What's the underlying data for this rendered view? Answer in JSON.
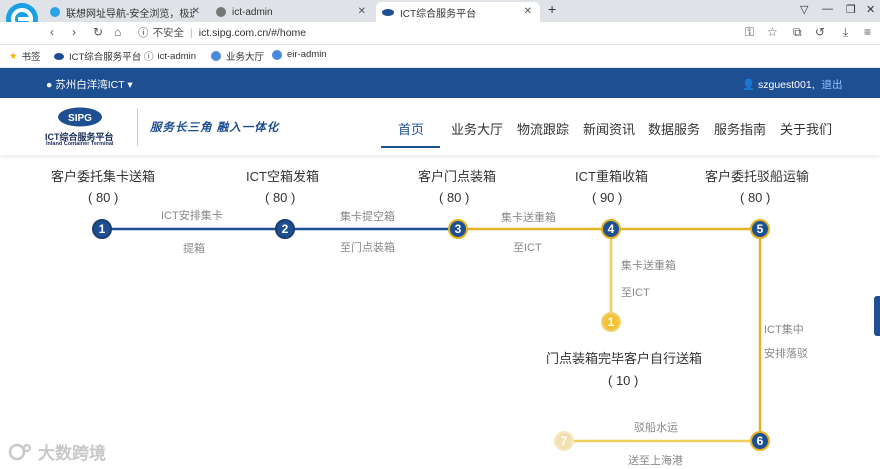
{
  "browser": {
    "tabs": [
      {
        "title": "联想网址导航-安全浏览，极速体验",
        "active": false
      },
      {
        "title": "ict-admin",
        "active": false
      },
      {
        "title": "ICT综合服务平台",
        "active": true
      }
    ],
    "new_tab": "+",
    "insecure_label": "不安全",
    "url": "ict.sipg.com.cn/#/home",
    "bookmarks": [
      "书签",
      "ICT综合服务平台",
      "ict-admin",
      "业务大厅",
      "eir-admin"
    ]
  },
  "topbar": {
    "location": "苏州白洋湾ICT",
    "user": "szguest001,",
    "logout": "退出"
  },
  "header": {
    "logo_text": "SIPG",
    "brand_title": "ICT综合服务平台",
    "brand_sub": "Inland Container Terminal",
    "slogan": "服务长三角 融入一体化",
    "menu": [
      "首页",
      "业务大厅",
      "物流跟踪",
      "新闻资讯",
      "数据服务",
      "服务指南",
      "关于我们"
    ],
    "active_menu": "首页"
  },
  "flow": {
    "stages": [
      {
        "num": "1",
        "title": "客户委托集卡送箱",
        "count": "( 80 )"
      },
      {
        "num": "2",
        "title": "ICT空箱发箱",
        "count": "( 80 )"
      },
      {
        "num": "3",
        "title": "客户门点装箱",
        "count": "( 80 )"
      },
      {
        "num": "4",
        "title": "ICT重箱收箱",
        "count": "( 90 )"
      },
      {
        "num": "5",
        "title": "客户委托驳船运输",
        "count": "( 80 )"
      }
    ],
    "branch": {
      "num": "1",
      "title": "门点装箱完毕客户自行送箱",
      "count": "( 10 )"
    },
    "node6": "6",
    "node7": "7",
    "labels": {
      "s12_top": "ICT安排集卡",
      "s12_bottom": "提箱",
      "s23_top": "集卡提空箱",
      "s23_bottom": "至门点装箱",
      "s34_top": "集卡送重箱",
      "s34_bottom": "至ICT",
      "branch_top": "集卡送重箱",
      "branch_bottom": "至ICT",
      "s56_top": "ICT集中",
      "s56_bottom": "安排落驳",
      "s67_top": "驳船水运",
      "s67_bottom": "送至上海港"
    }
  },
  "watermark": "大数跨境",
  "colors": {
    "brand_blue": "#1f4f93",
    "gold": "#e2b324"
  }
}
